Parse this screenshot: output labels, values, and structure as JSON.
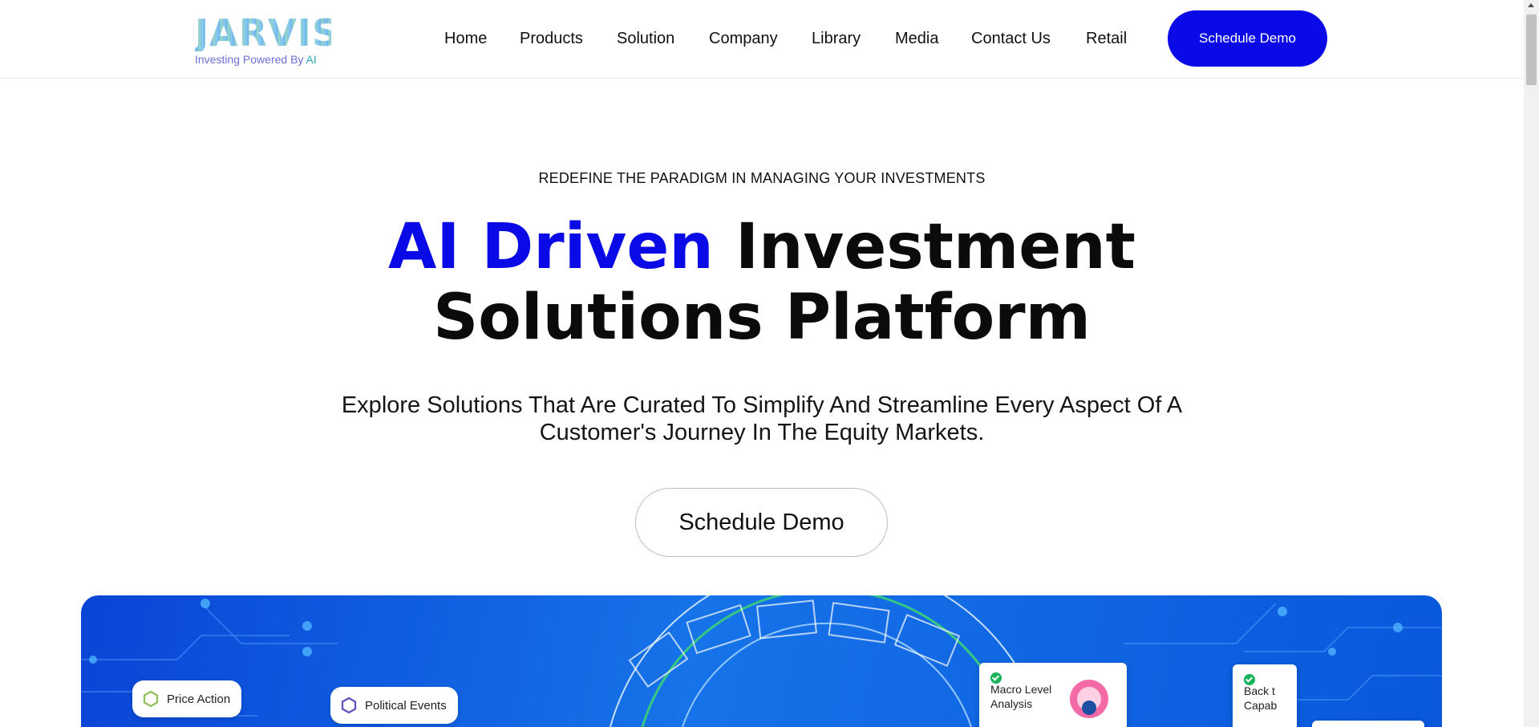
{
  "brand": {
    "logo_text": "JARVIS",
    "registered": "®",
    "tagline_prefix": "Investing Powered By ",
    "tagline_ai": "AI"
  },
  "nav": {
    "items": [
      "Home",
      "Products",
      "Solution",
      "Company",
      "Library",
      "Media",
      "Contact Us",
      "Retail"
    ],
    "cta_label": "Schedule Demo"
  },
  "hero": {
    "eyebrow": "REDEFINE THE PARADIGM IN MANAGING YOUR INVESTMENTS",
    "headline_blue": "AI Driven",
    "headline_rest_line1": " Investment",
    "headline_line2": "Solutions Platform",
    "subheadline": "Explore Solutions That Are Curated To Simplify And Streamline Every Aspect Of A Customer's Journey In The Equity Markets.",
    "cta_label": "Schedule Demo"
  },
  "banner": {
    "chips": [
      "Price Action",
      "Political Events"
    ],
    "cards": [
      "Macro Level Analysis",
      "Back t Capab"
    ]
  },
  "colors": {
    "accent": "#0a0ae6",
    "banner_blue": "#1673e8",
    "check_green": "#19b35a"
  }
}
